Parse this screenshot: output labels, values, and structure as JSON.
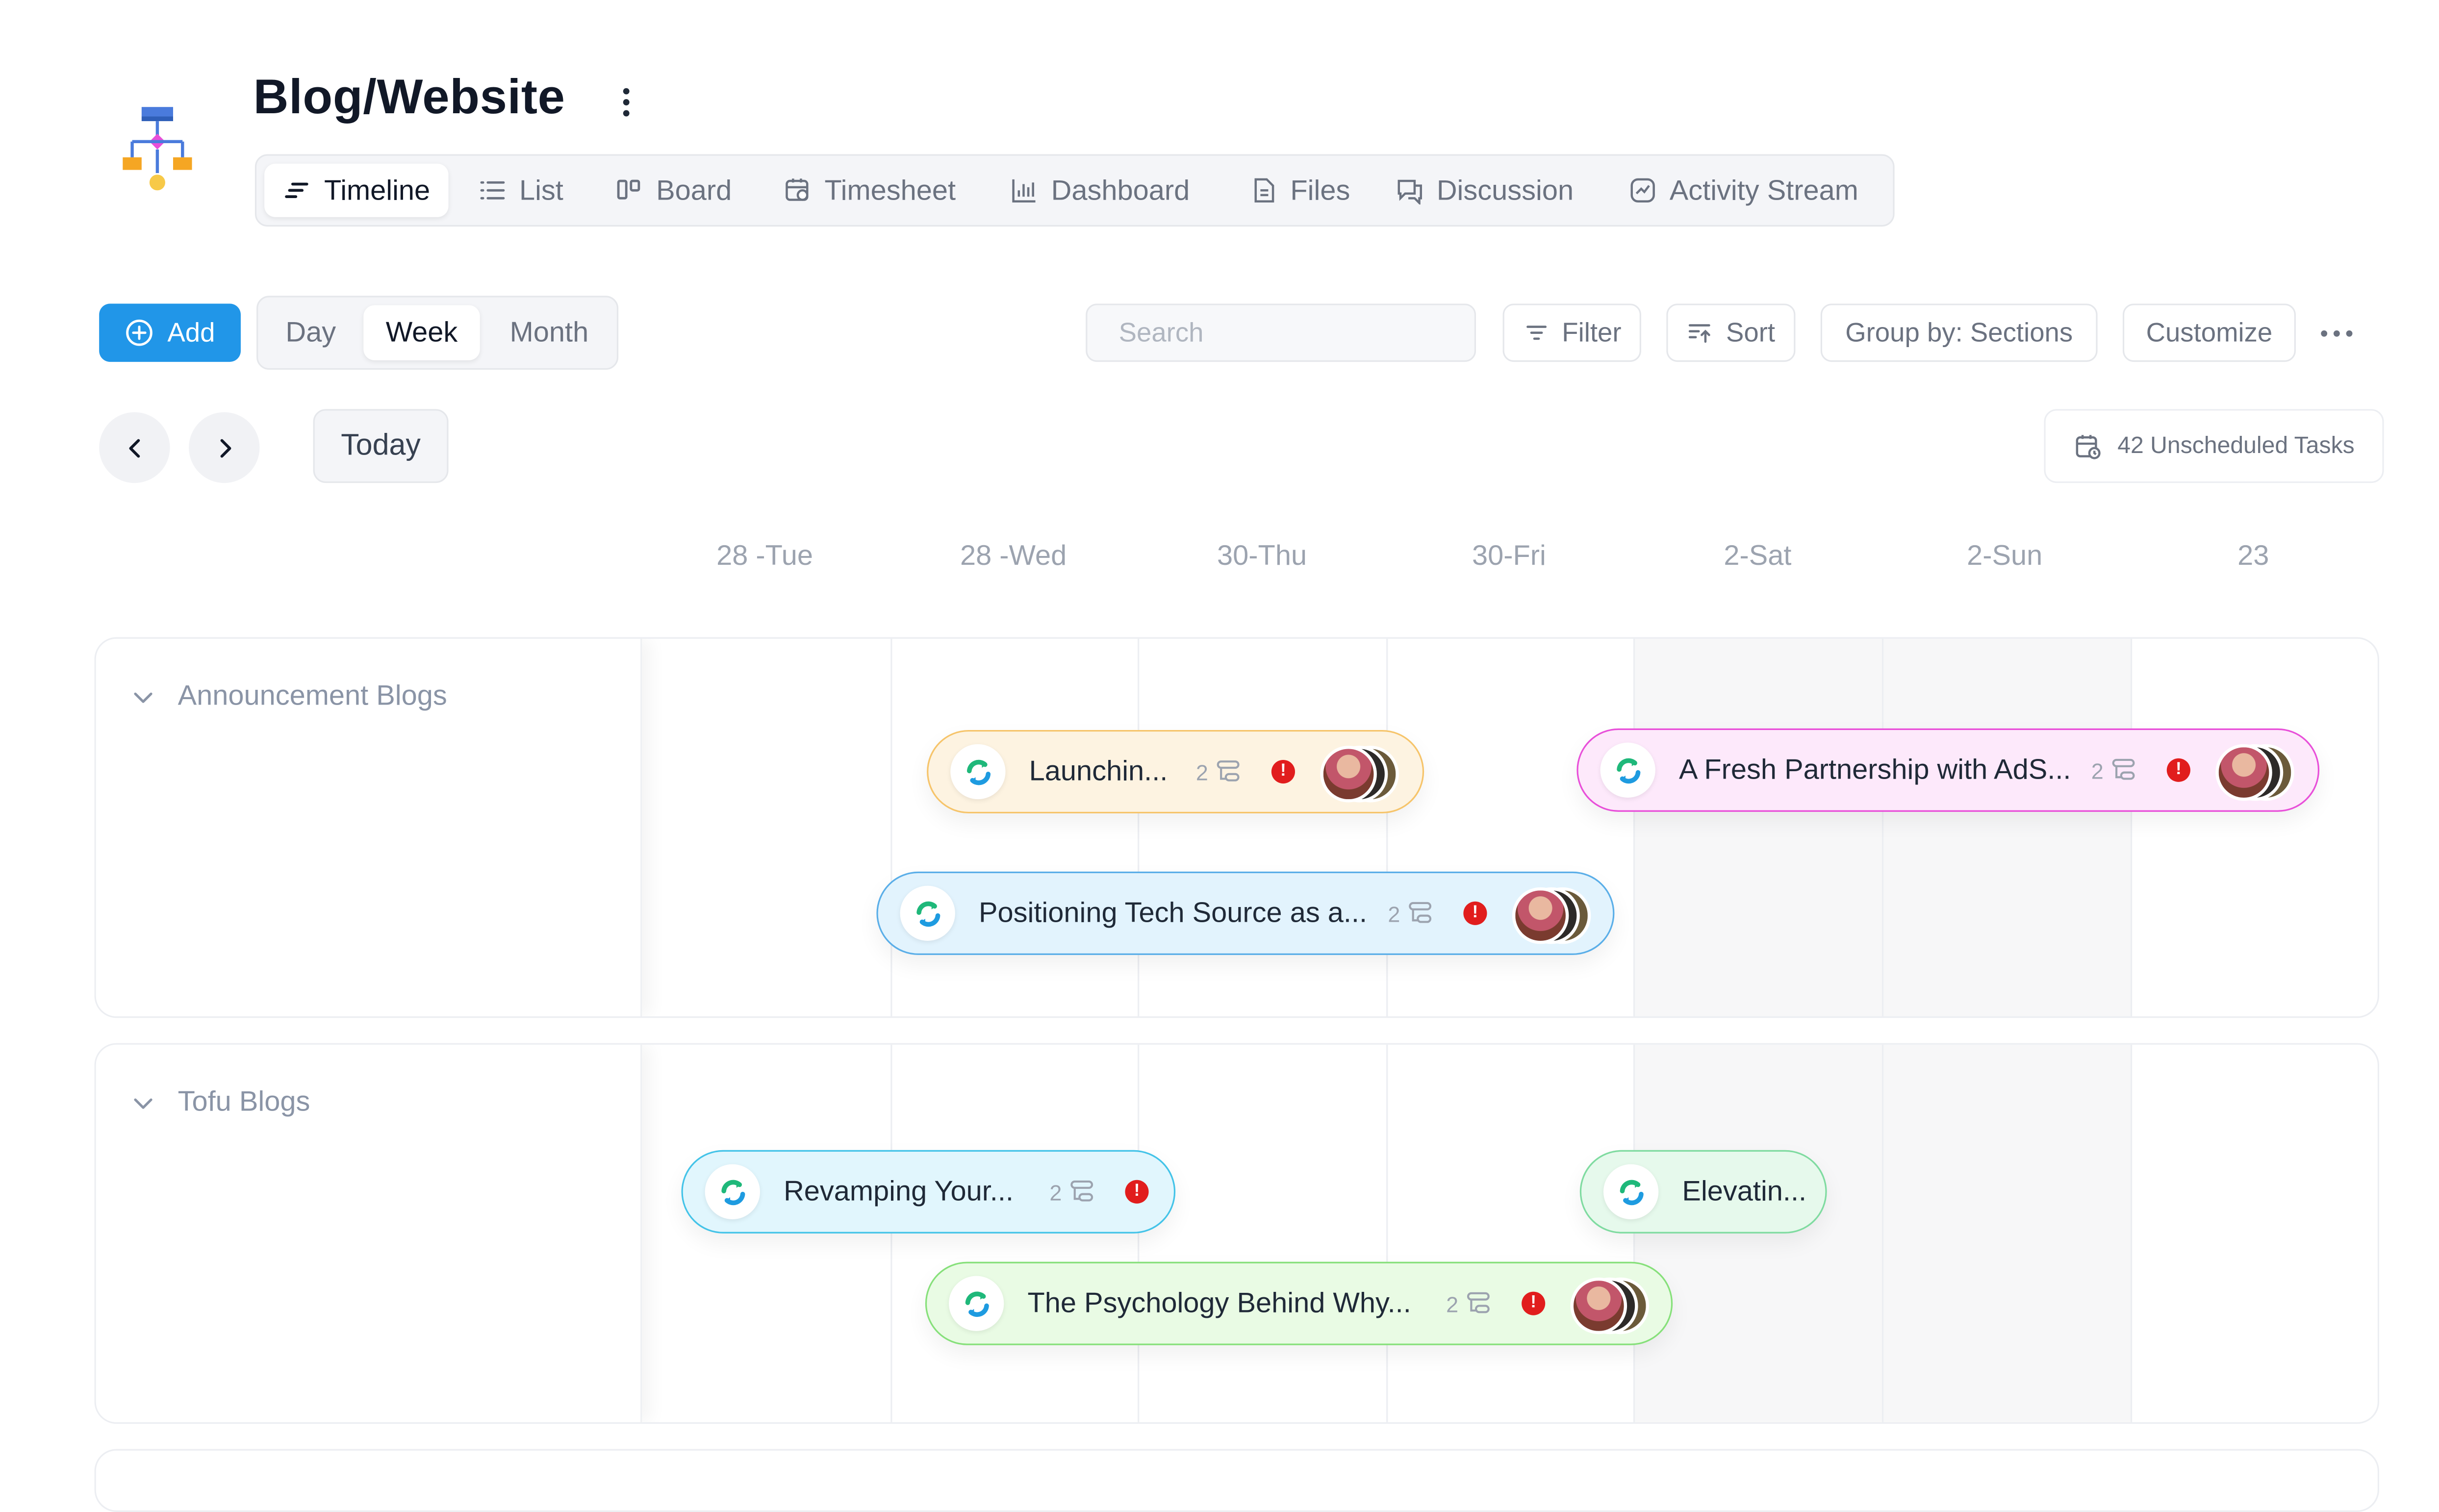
{
  "project": {
    "title": "Blog/Website",
    "icon": "sitemap-icon"
  },
  "tabs": [
    {
      "label": "Timeline",
      "icon": "timeline-icon",
      "active": true
    },
    {
      "label": "List",
      "icon": "list-icon",
      "active": false
    },
    {
      "label": "Board",
      "icon": "board-icon",
      "active": false
    },
    {
      "label": "Timesheet",
      "icon": "calendar-clock-icon",
      "active": false
    },
    {
      "label": "Dashboard",
      "icon": "bar-chart-icon",
      "active": false
    },
    {
      "label": "Files",
      "icon": "file-icon",
      "active": false
    },
    {
      "label": "Discussion",
      "icon": "chat-icon",
      "active": false
    },
    {
      "label": "Activity Stream",
      "icon": "activity-icon",
      "active": false
    }
  ],
  "toolbar": {
    "add_label": "Add",
    "view_modes": [
      "Day",
      "Week",
      "Month"
    ],
    "active_view": "Week",
    "search_placeholder": "Search",
    "filter_label": "Filter",
    "sort_label": "Sort",
    "group_by_label": "Group by: Sections",
    "customize_label": "Customize",
    "accent_color": "#2196e8"
  },
  "navigation": {
    "today_label": "Today",
    "unscheduled_label": "42 Unscheduled Tasks"
  },
  "days": [
    "28 -Tue",
    "28 -Wed",
    "30-Thu",
    "30-Fri",
    "2-Sat",
    "2-Sun",
    "23"
  ],
  "sections": [
    {
      "name": "Announcement Blogs",
      "tasks": [
        {
          "name": "Launchin...",
          "subtasks": "2",
          "color": "#f6c46a",
          "bg": "#fdf3e1"
        },
        {
          "name": "A Fresh Partnership with AdS...",
          "subtasks": "2",
          "color": "#e84fd9",
          "bg": "#fde9fb"
        },
        {
          "name": "Positioning Tech Source as a...",
          "subtasks": "2",
          "color": "#5aaee8",
          "bg": "#e2f3fd"
        }
      ]
    },
    {
      "name": "Tofu Blogs",
      "tasks": [
        {
          "name": "Revamping Your...",
          "subtasks": "2",
          "color": "#43c3e8",
          "bg": "#e1f6fd"
        },
        {
          "name": "Elevatin...",
          "subtasks": "",
          "color": "#7fdba0",
          "bg": "#e6f9ec"
        },
        {
          "name": "The Psychology Behind Why...",
          "subtasks": "2",
          "color": "#86e07a",
          "bg": "#e9fbe4"
        }
      ]
    }
  ]
}
